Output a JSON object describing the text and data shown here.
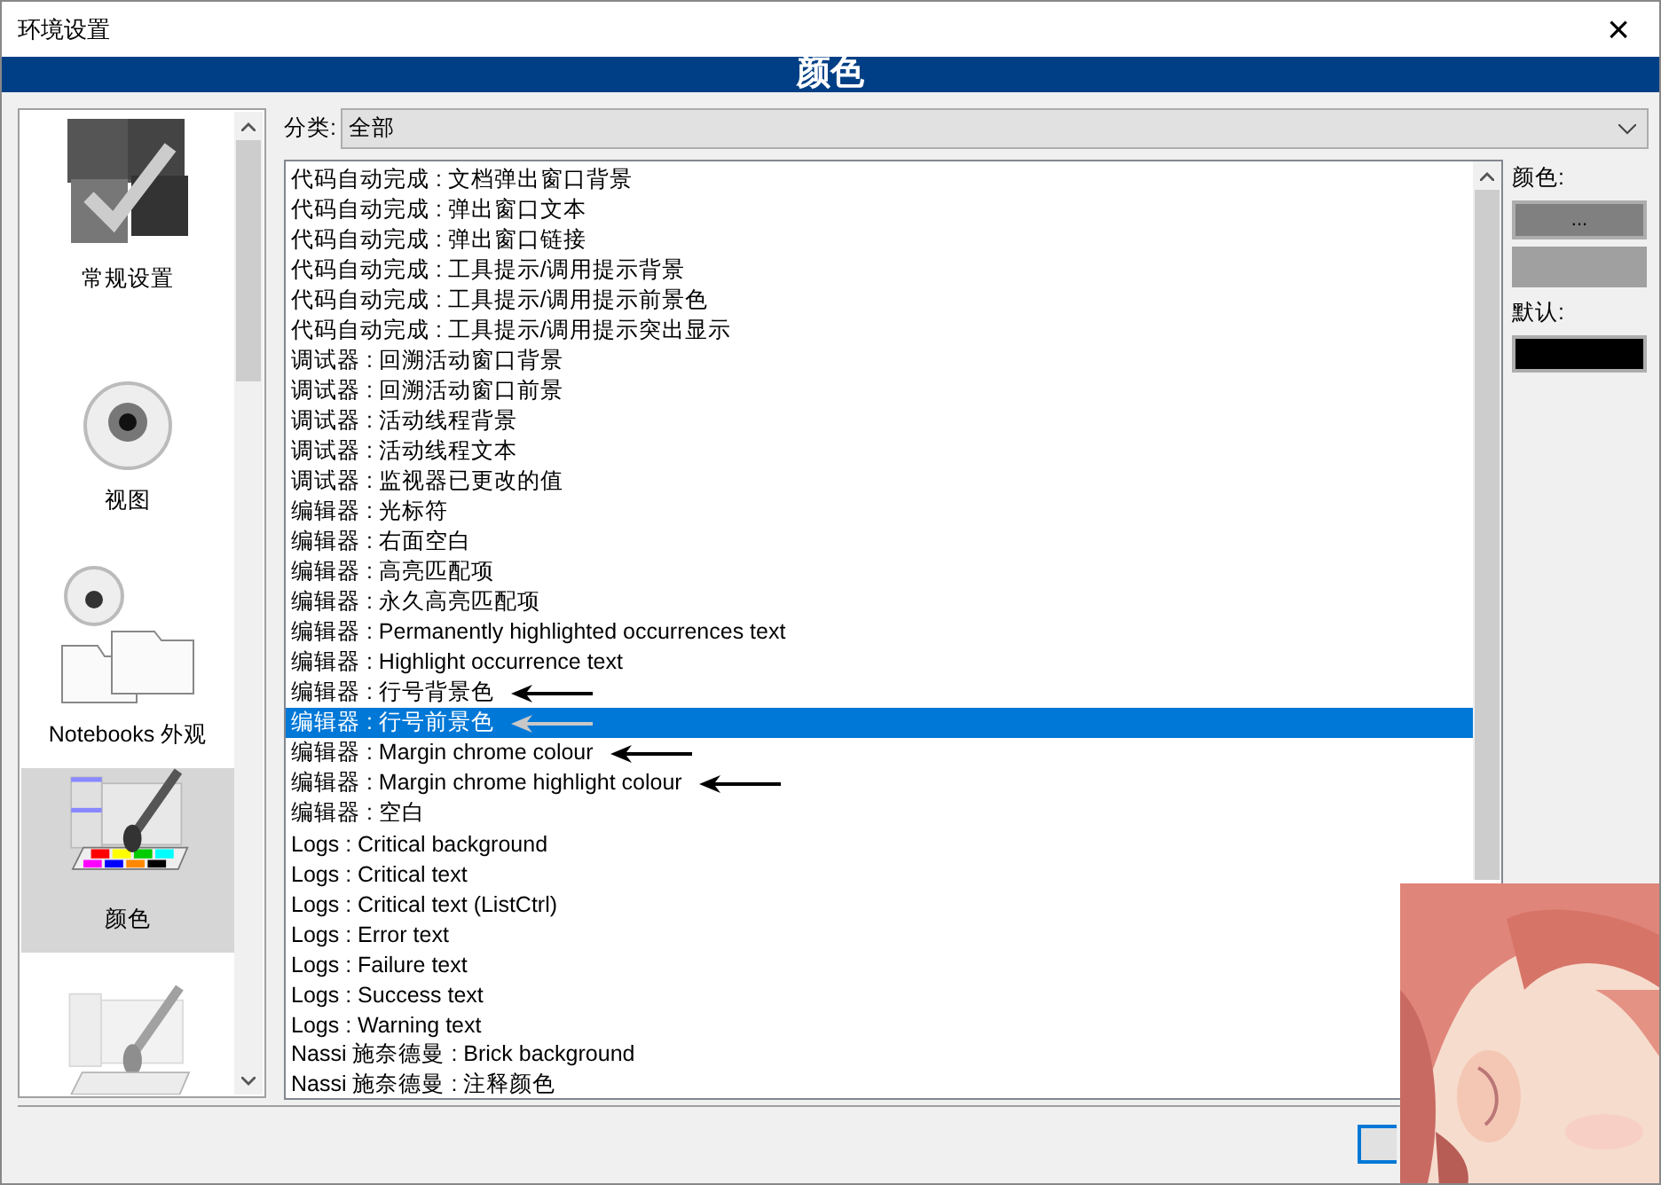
{
  "window": {
    "title": "环境设置",
    "close": "×"
  },
  "header": {
    "title": "颜色"
  },
  "sidebar": {
    "items": [
      {
        "label": "常规设置",
        "selected": false
      },
      {
        "label": "视图",
        "selected": false
      },
      {
        "label": "Notebooks 外观",
        "selected": false
      },
      {
        "label": "颜色",
        "selected": true
      }
    ]
  },
  "category": {
    "label": "分类:",
    "value": "全部"
  },
  "list": {
    "items": [
      {
        "text": "代码自动完成 : 文档弹出窗口背景",
        "selected": false,
        "arrow": false
      },
      {
        "text": "代码自动完成 : 弹出窗口文本",
        "selected": false,
        "arrow": false
      },
      {
        "text": "代码自动完成 : 弹出窗口链接",
        "selected": false,
        "arrow": false
      },
      {
        "text": "代码自动完成 : 工具提示/调用提示背景",
        "selected": false,
        "arrow": false
      },
      {
        "text": "代码自动完成 : 工具提示/调用提示前景色",
        "selected": false,
        "arrow": false
      },
      {
        "text": "代码自动完成 : 工具提示/调用提示突出显示",
        "selected": false,
        "arrow": false
      },
      {
        "text": "调试器 : 回溯活动窗口背景",
        "selected": false,
        "arrow": false
      },
      {
        "text": "调试器 : 回溯活动窗口前景",
        "selected": false,
        "arrow": false
      },
      {
        "text": "调试器 : 活动线程背景",
        "selected": false,
        "arrow": false
      },
      {
        "text": "调试器 : 活动线程文本",
        "selected": false,
        "arrow": false
      },
      {
        "text": "调试器 : 监视器已更改的值",
        "selected": false,
        "arrow": false
      },
      {
        "text": "编辑器 : 光标符",
        "selected": false,
        "arrow": false
      },
      {
        "text": "编辑器 : 右面空白",
        "selected": false,
        "arrow": false
      },
      {
        "text": "编辑器 : 高亮匹配项",
        "selected": false,
        "arrow": false
      },
      {
        "text": "编辑器 : 永久高亮匹配项",
        "selected": false,
        "arrow": false
      },
      {
        "text": "编辑器 : Permanently highlighted occurrences text",
        "selected": false,
        "arrow": false
      },
      {
        "text": "编辑器 : Highlight occurrence text",
        "selected": false,
        "arrow": false
      },
      {
        "text": "编辑器 : 行号背景色",
        "selected": false,
        "arrow": true
      },
      {
        "text": "编辑器 : 行号前景色",
        "selected": true,
        "arrow": true
      },
      {
        "text": "编辑器 : Margin chrome colour",
        "selected": false,
        "arrow": true
      },
      {
        "text": "编辑器 : Margin chrome highlight colour",
        "selected": false,
        "arrow": true
      },
      {
        "text": "编辑器 : 空白",
        "selected": false,
        "arrow": false
      },
      {
        "text": "Logs : Critical background",
        "selected": false,
        "arrow": false
      },
      {
        "text": "Logs : Critical text",
        "selected": false,
        "arrow": false
      },
      {
        "text": "Logs : Critical text (ListCtrl)",
        "selected": false,
        "arrow": false
      },
      {
        "text": "Logs : Error text",
        "selected": false,
        "arrow": false
      },
      {
        "text": "Logs : Failure text",
        "selected": false,
        "arrow": false
      },
      {
        "text": "Logs : Success text",
        "selected": false,
        "arrow": false
      },
      {
        "text": "Logs : Warning text",
        "selected": false,
        "arrow": false
      },
      {
        "text": "Nassi 施奈德曼 : Brick background",
        "selected": false,
        "arrow": false
      },
      {
        "text": "Nassi 施奈德曼 : 注释颜色",
        "selected": false,
        "arrow": false
      }
    ]
  },
  "color_panel": {
    "current": {
      "label": "颜色:",
      "button": "...",
      "color": "#a0a0a0"
    },
    "default": {
      "label": "默认:",
      "color": "#000000"
    }
  }
}
